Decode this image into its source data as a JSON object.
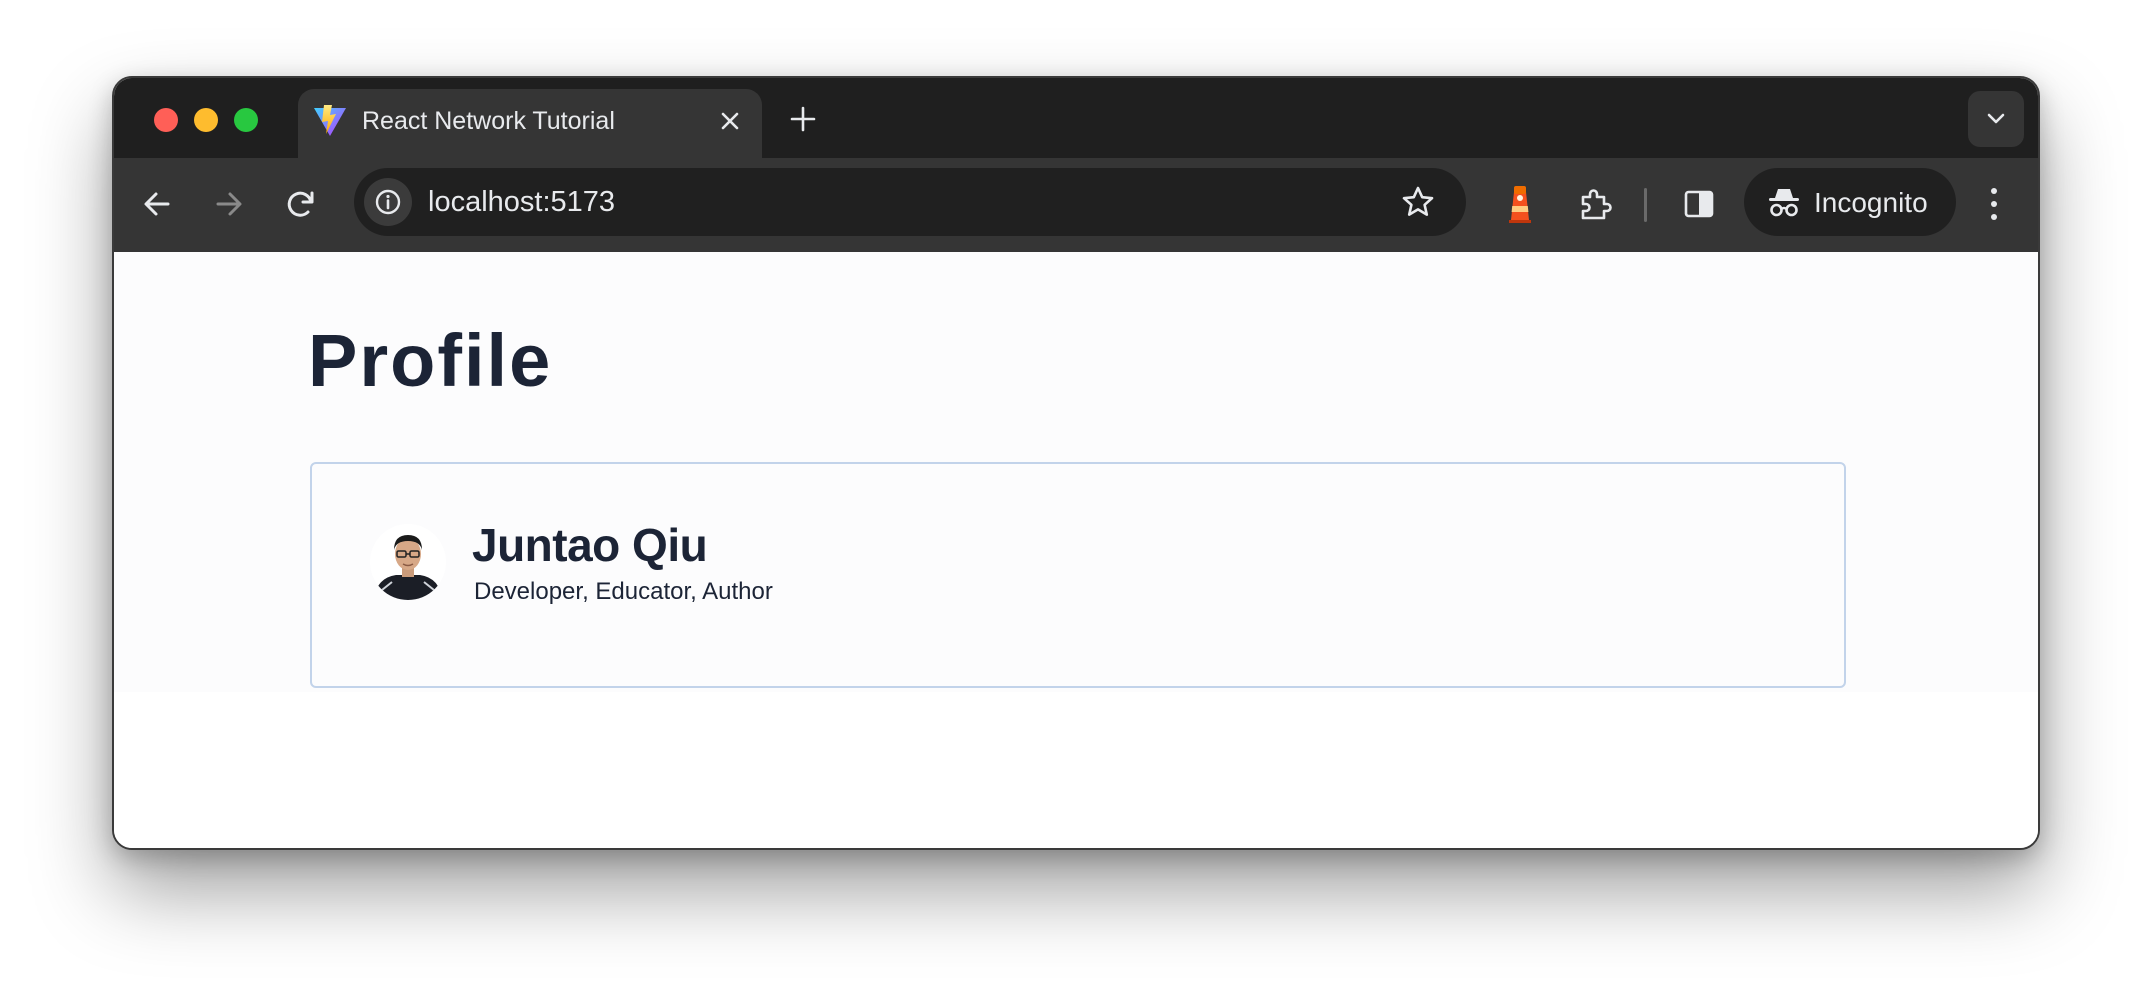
{
  "browser": {
    "tab": {
      "title": "React Network Tutorial"
    },
    "address_bar": {
      "url": "localhost:5173"
    },
    "incognito_label": "Incognito"
  },
  "page": {
    "title": "Profile",
    "profile": {
      "name": "Juntao Qiu",
      "bio": "Developer, Educator, Author"
    }
  },
  "colors": {
    "tab_strip": "#1f1f1f",
    "toolbar": "#353535",
    "heading_text": "#1c2436",
    "card_border": "#c2d3ea",
    "traffic_close": "#ff5f57",
    "traffic_minimize": "#febc2e",
    "traffic_maximize": "#28c840"
  },
  "icons": {
    "favicon": "vite-logo-icon",
    "back": "arrow-left-icon",
    "forward": "arrow-right-icon",
    "reload": "reload-icon",
    "site_info": "info-circle-icon",
    "bookmark": "star-icon",
    "extension_1": "lighthouse-icon",
    "extensions": "puzzle-icon",
    "side_panel": "side-panel-icon",
    "incognito": "incognito-icon",
    "menu": "kebab-menu-icon"
  }
}
